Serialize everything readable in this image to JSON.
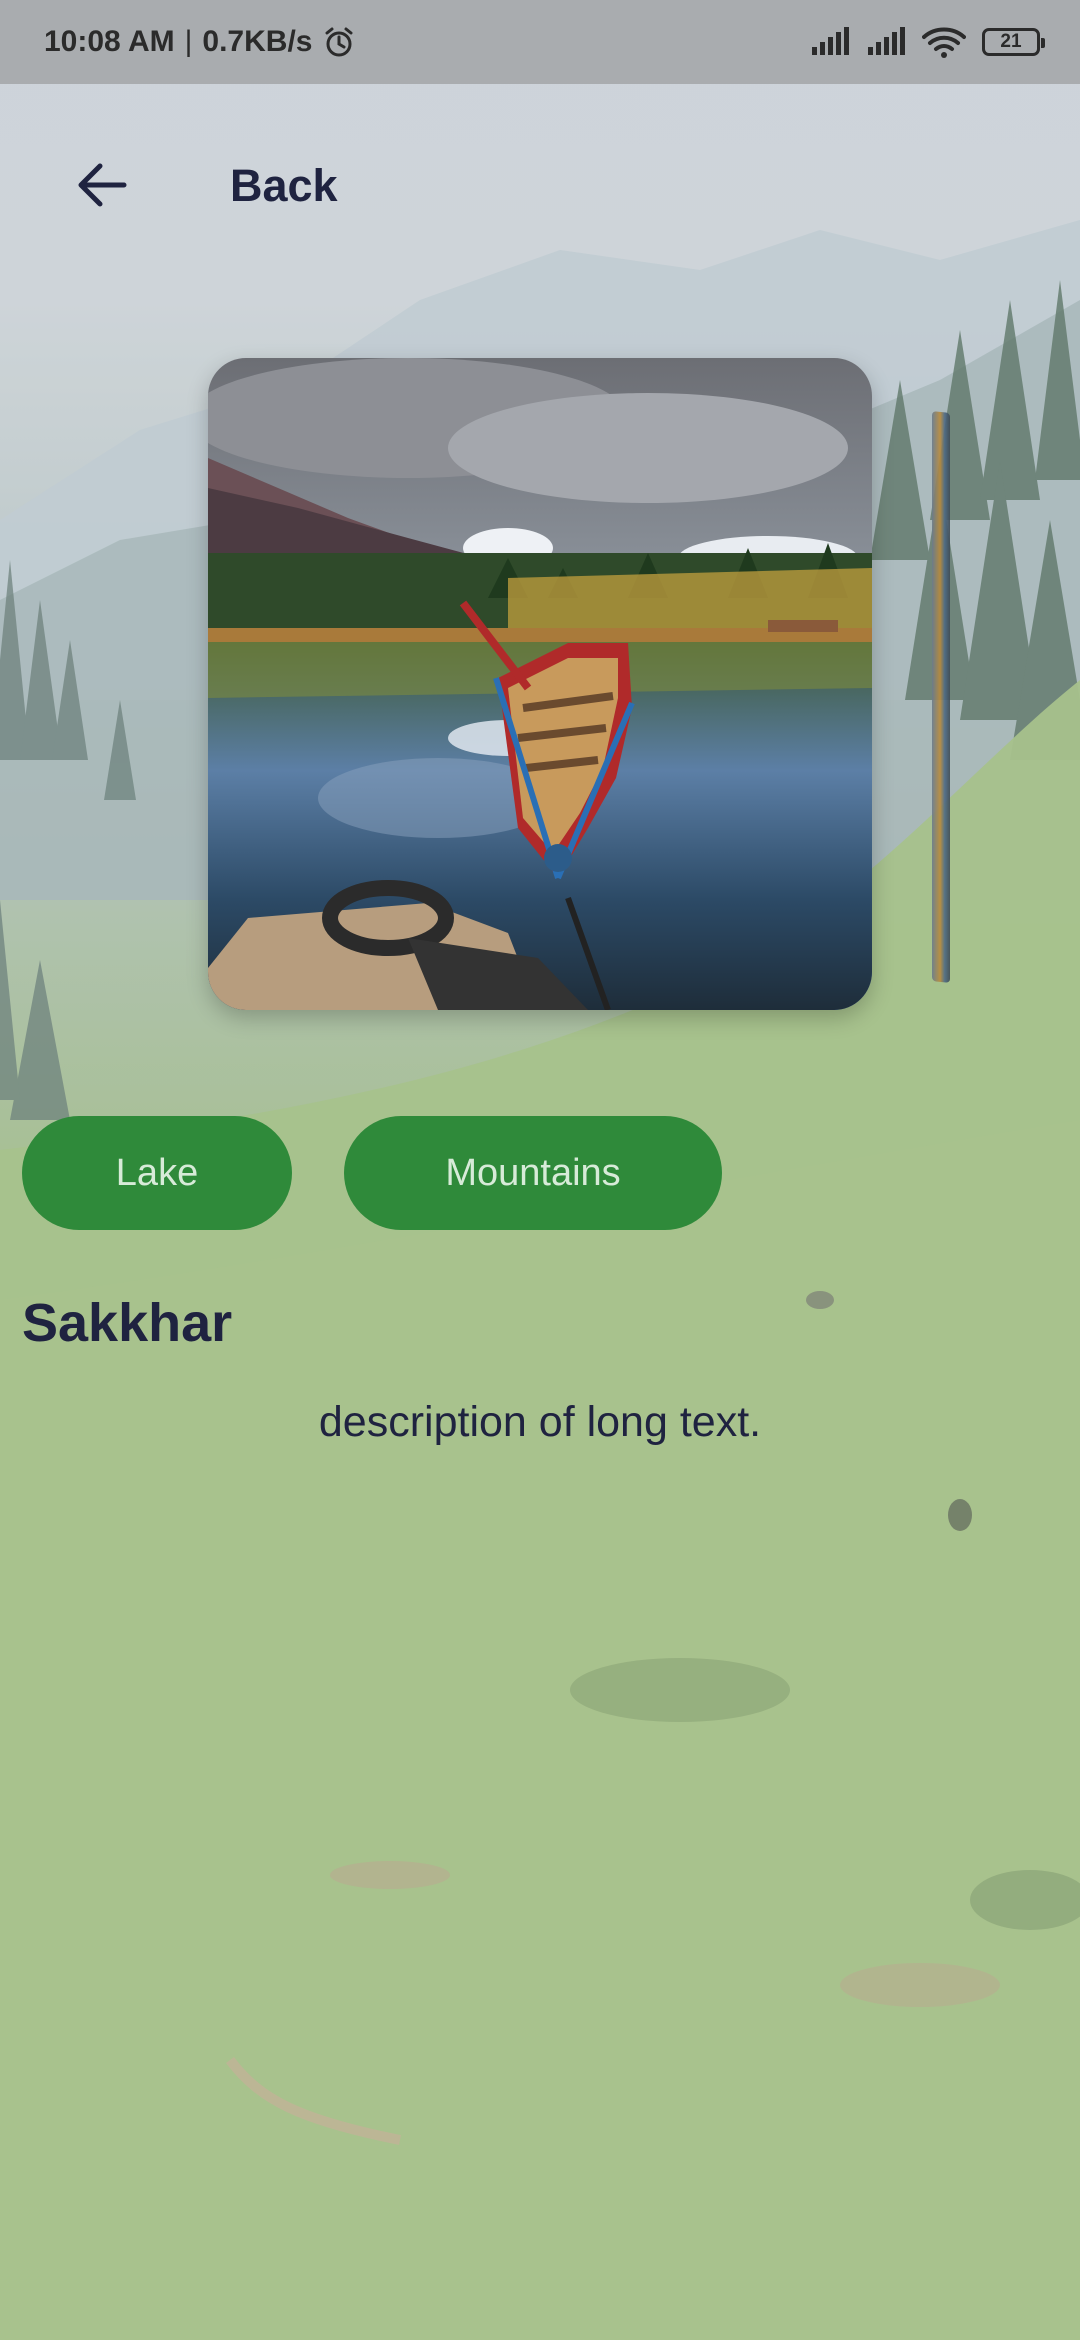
{
  "status_bar": {
    "time": "10:08 AM",
    "separator": "|",
    "speed": "0.7KB/s",
    "battery": "21",
    "icons": [
      "alarm-icon",
      "signal-icon",
      "signal-icon",
      "wifi-icon",
      "battery-icon"
    ]
  },
  "header": {
    "back_label": "Back",
    "back_icon": "arrow-left-icon"
  },
  "chips": [
    {
      "label": "Lake"
    },
    {
      "label": "Mountains"
    }
  ],
  "place": {
    "title": "Sakkhar",
    "description": "description of long text."
  },
  "colors": {
    "chip_background": "#2f8a3a",
    "chip_text": "#d7ebd8",
    "title_text": "#1f2340"
  }
}
